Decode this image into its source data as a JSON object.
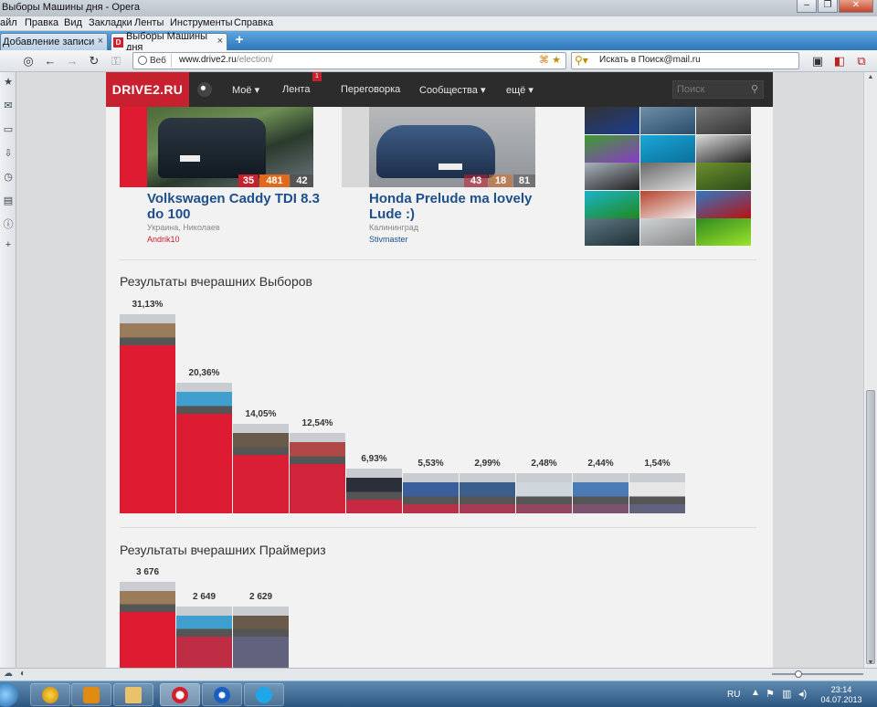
{
  "window": {
    "title": "Выборы Машины дня - Opera"
  },
  "menu": [
    "айл",
    "Правка",
    "Вид",
    "Закладки",
    "Ленты",
    "Инструменты",
    "Справка"
  ],
  "tabs": [
    {
      "label": "Добавление записи",
      "active": false
    },
    {
      "label": "Выборы Машины дня",
      "active": true
    }
  ],
  "address": {
    "mode": "Веб",
    "domain": "www.drive2.ru",
    "path": "/election/"
  },
  "search_field": {
    "placeholder": "Искать в Поиск@mail.ru"
  },
  "site": {
    "logo": "DRIVE2.RU",
    "nav": [
      {
        "label": "Моё",
        "dropdown": true
      },
      {
        "label": "Лента",
        "dropdown": false,
        "badge": "1"
      },
      {
        "label": "Переговорка",
        "dropdown": false
      },
      {
        "label": "Сообщества",
        "dropdown": true
      },
      {
        "label": "ещё",
        "dropdown": true
      }
    ],
    "search_placeholder": "Поиск"
  },
  "cards": [
    {
      "title": "Volkswagen Caddy TDI 8.3 do 100",
      "location": "Украина, Николаев",
      "user": "Andrik10",
      "stats": [
        "35",
        "481",
        "42"
      ],
      "user_color": "#c7202f"
    },
    {
      "title": "Honda Prelude ma lovely Lude :)",
      "location": "Калининград",
      "user": "Stivmaster",
      "stats": [
        "43",
        "18",
        "81"
      ],
      "user_color": "#1d4f8c"
    }
  ],
  "elections": {
    "title": "Результаты вчерашних Выборов",
    "results": [
      {
        "label": "31,13%",
        "value": 31.13
      },
      {
        "label": "20,36%",
        "value": 20.36
      },
      {
        "label": "14,05%",
        "value": 14.05
      },
      {
        "label": "12,54%",
        "value": 12.54
      },
      {
        "label": "6,93%",
        "value": 6.93
      },
      {
        "label": "5,53%",
        "value": 5.53
      },
      {
        "label": "2,99%",
        "value": 2.99
      },
      {
        "label": "2,48%",
        "value": 2.48
      },
      {
        "label": "2,44%",
        "value": 2.44
      },
      {
        "label": "1,54%",
        "value": 1.54
      }
    ]
  },
  "primaries": {
    "title": "Результаты вчерашних Праймериз",
    "results": [
      {
        "label": "3 676",
        "value": 3676
      },
      {
        "label": "2 649",
        "value": 2649
      },
      {
        "label": "2 629",
        "value": 2629
      }
    ]
  },
  "taskbar": {
    "lang": "RU",
    "time": "23:14",
    "date": "04.07.2013"
  },
  "colors": {
    "brand": "#c7202f",
    "bar_red": "#df1b32",
    "nav_bg": "#2c2c2c",
    "link": "#1d4f8c"
  }
}
